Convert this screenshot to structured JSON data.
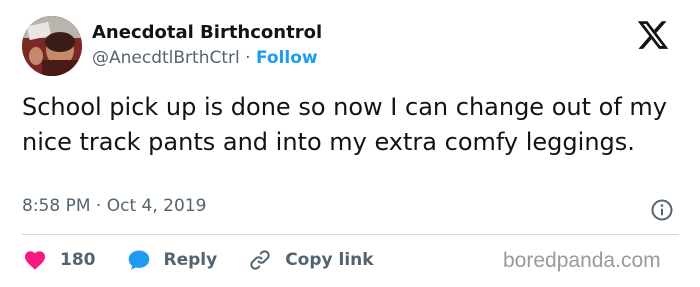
{
  "author": {
    "name": "Anecdotal Birthcontrol",
    "handle": "@AnecdtlBrthCtrl",
    "separator": "·",
    "follow_label": "Follow"
  },
  "tweet": {
    "text": "School pick up is done so now I can change out of my nice track pants and into my extra comfy leggings.",
    "time": "8:58 PM",
    "separator": "·",
    "date": "Oct 4, 2019"
  },
  "actions": {
    "likes_count": "180",
    "reply_label": "Reply",
    "copy_link_label": "Copy link"
  },
  "watermark": "boredpanda.com",
  "icons": {
    "logo": "x-logo-icon",
    "info": "info-icon",
    "like": "heart-icon",
    "reply": "speech-bubble-icon",
    "copy_link": "link-icon"
  },
  "colors": {
    "text": "#0f1419",
    "secondary": "#536471",
    "accent": "#1d9bf0",
    "like": "#f91880",
    "divider": "#cfd9de"
  }
}
